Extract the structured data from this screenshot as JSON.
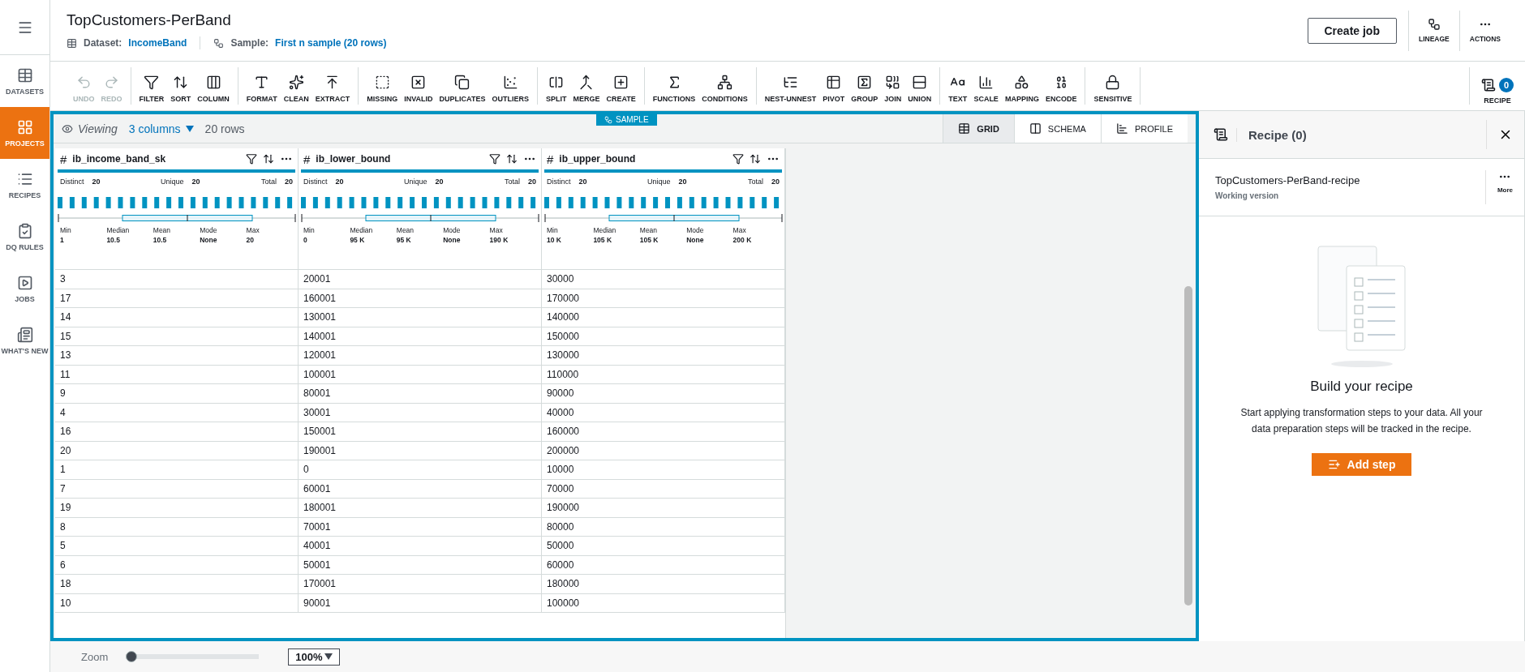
{
  "sidebar": {
    "items": [
      {
        "label": "DATASETS",
        "selected": false
      },
      {
        "label": "PROJECTS",
        "selected": true
      },
      {
        "label": "RECIPES",
        "selected": false
      },
      {
        "label": "DQ RULES",
        "selected": false
      },
      {
        "label": "JOBS",
        "selected": false
      },
      {
        "label": "WHAT'S NEW",
        "selected": false
      }
    ]
  },
  "header": {
    "title": "TopCustomers-PerBand",
    "dataset_label": "Dataset:",
    "dataset": "IncomeBand",
    "sample_label": "Sample:",
    "sample": "First n sample (20 rows)",
    "create_job": "Create job",
    "actions": [
      {
        "label": "LINEAGE"
      },
      {
        "label": "ACTIONS"
      }
    ]
  },
  "toolbar": {
    "groups": [
      [
        {
          "label": "UNDO",
          "disabled": true
        },
        {
          "label": "REDO",
          "disabled": true
        }
      ],
      [
        {
          "label": "FILTER",
          "disabled": false
        },
        {
          "label": "SORT",
          "disabled": false
        },
        {
          "label": "COLUMN",
          "disabled": false
        }
      ],
      [
        {
          "label": "FORMAT",
          "disabled": false
        },
        {
          "label": "CLEAN",
          "disabled": false
        },
        {
          "label": "EXTRACT",
          "disabled": false
        }
      ],
      [
        {
          "label": "MISSING",
          "disabled": false
        },
        {
          "label": "INVALID",
          "disabled": false
        },
        {
          "label": "DUPLICATES",
          "disabled": false
        },
        {
          "label": "OUTLIERS",
          "disabled": false
        }
      ],
      [
        {
          "label": "SPLIT",
          "disabled": false
        },
        {
          "label": "MERGE",
          "disabled": false
        },
        {
          "label": "CREATE",
          "disabled": false
        }
      ],
      [
        {
          "label": "FUNCTIONS",
          "disabled": false
        },
        {
          "label": "CONDITIONS",
          "disabled": false
        }
      ],
      [
        {
          "label": "NEST-UNNEST",
          "disabled": false
        },
        {
          "label": "PIVOT",
          "disabled": false
        },
        {
          "label": "GROUP",
          "disabled": false
        },
        {
          "label": "JOIN",
          "disabled": false
        },
        {
          "label": "UNION",
          "disabled": false
        }
      ],
      [
        {
          "label": "TEXT",
          "disabled": false
        },
        {
          "label": "SCALE",
          "disabled": false
        },
        {
          "label": "MAPPING",
          "disabled": false
        },
        {
          "label": "ENCODE",
          "disabled": false
        }
      ],
      [
        {
          "label": "SENSITIVE",
          "disabled": false
        }
      ]
    ],
    "recipe": {
      "label": "RECIPE",
      "count": "0"
    }
  },
  "grid": {
    "viewing": "Viewing",
    "columns_selector": "3 columns",
    "row_count": "20 rows",
    "badge": "SAMPLE",
    "views": [
      {
        "label": "GRID",
        "selected": true
      },
      {
        "label": "SCHEMA",
        "selected": false
      },
      {
        "label": "PROFILE",
        "selected": false
      }
    ],
    "columns": [
      {
        "type": "#",
        "name": "ib_income_band_sk",
        "stats": [
          {
            "label": "Distinct",
            "value": "20"
          },
          {
            "label": "Unique",
            "value": "20"
          },
          {
            "label": "Total",
            "value": "20"
          }
        ],
        "summary": [
          {
            "label": "Min",
            "value": "1"
          },
          {
            "label": "Median",
            "value": "10.5"
          },
          {
            "label": "Mean",
            "value": "10.5"
          },
          {
            "label": "Mode",
            "value": "None"
          },
          {
            "label": "Max",
            "value": "20"
          }
        ]
      },
      {
        "type": "#",
        "name": "ib_lower_bound",
        "stats": [
          {
            "label": "Distinct",
            "value": "20"
          },
          {
            "label": "Unique",
            "value": "20"
          },
          {
            "label": "Total",
            "value": "20"
          }
        ],
        "summary": [
          {
            "label": "Min",
            "value": "0"
          },
          {
            "label": "Median",
            "value": "95 K"
          },
          {
            "label": "Mean",
            "value": "95 K"
          },
          {
            "label": "Mode",
            "value": "None"
          },
          {
            "label": "Max",
            "value": "190 K"
          }
        ]
      },
      {
        "type": "#",
        "name": "ib_upper_bound",
        "stats": [
          {
            "label": "Distinct",
            "value": "20"
          },
          {
            "label": "Unique",
            "value": "20"
          },
          {
            "label": "Total",
            "value": "20"
          }
        ],
        "summary": [
          {
            "label": "Min",
            "value": "10 K"
          },
          {
            "label": "Median",
            "value": "105 K"
          },
          {
            "label": "Mean",
            "value": "105 K"
          },
          {
            "label": "Mode",
            "value": "None"
          },
          {
            "label": "Max",
            "value": "200 K"
          }
        ]
      }
    ],
    "rows": [
      [
        "3",
        "20001",
        "30000"
      ],
      [
        "17",
        "160001",
        "170000"
      ],
      [
        "14",
        "130001",
        "140000"
      ],
      [
        "15",
        "140001",
        "150000"
      ],
      [
        "13",
        "120001",
        "130000"
      ],
      [
        "11",
        "100001",
        "110000"
      ],
      [
        "9",
        "80001",
        "90000"
      ],
      [
        "4",
        "30001",
        "40000"
      ],
      [
        "16",
        "150001",
        "160000"
      ],
      [
        "20",
        "190001",
        "200000"
      ],
      [
        "1",
        "0",
        "10000"
      ],
      [
        "7",
        "60001",
        "70000"
      ],
      [
        "19",
        "180001",
        "190000"
      ],
      [
        "8",
        "70001",
        "80000"
      ],
      [
        "5",
        "40001",
        "50000"
      ],
      [
        "6",
        "50001",
        "60000"
      ],
      [
        "18",
        "170001",
        "180000"
      ],
      [
        "10",
        "90001",
        "100000"
      ]
    ]
  },
  "recipe_panel": {
    "title": "Recipe (0)",
    "recipe_name": "TopCustomers-PerBand-recipe",
    "version": "Working version",
    "more": "More",
    "empty_title": "Build your recipe",
    "empty_text": "Start applying transformation steps to your data. All your data preparation steps will be tracked in the recipe.",
    "add_step": "Add step"
  },
  "footer": {
    "zoom_label": "Zoom",
    "zoom": {
      "level": 0
    },
    "zoom_value": "100%"
  }
}
